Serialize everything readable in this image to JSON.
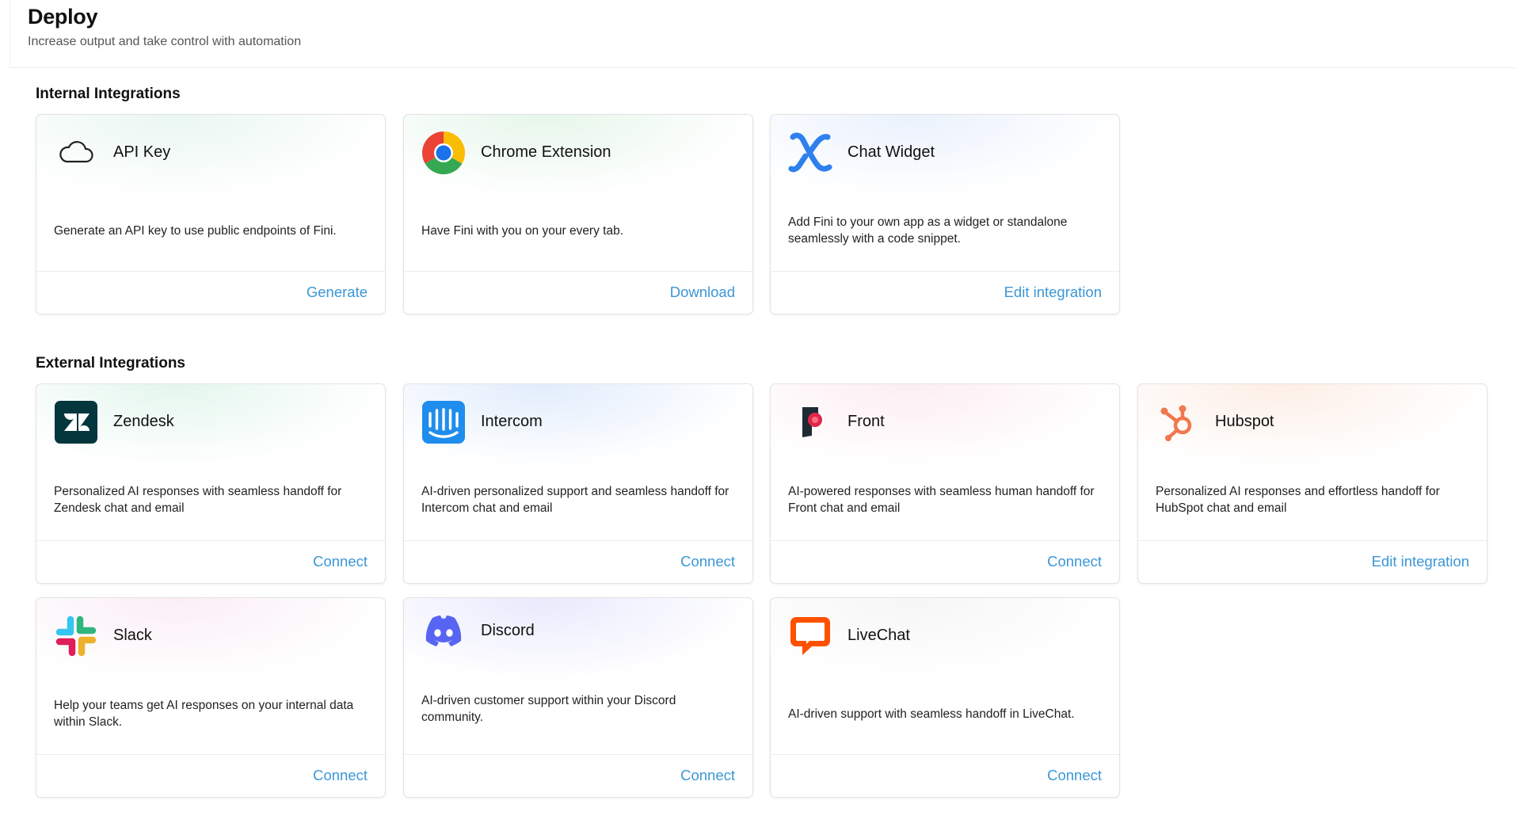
{
  "header": {
    "title": "Deploy",
    "subtitle": "Increase output and take control with automation"
  },
  "internal": {
    "title": "Internal Integrations",
    "cards": [
      {
        "name": "API Key",
        "description": "Generate an API key to use public endpoints of Fini.",
        "action": "Generate",
        "icon": "cloud-icon"
      },
      {
        "name": "Chrome Extension",
        "description": "Have Fini with you on your every tab.",
        "action": "Download",
        "icon": "chrome-icon"
      },
      {
        "name": "Chat Widget",
        "description": "Add Fini to your own app as a widget or standalone seamlessly with a code snippet.",
        "action": "Edit integration",
        "icon": "fini-logo-icon"
      }
    ]
  },
  "external": {
    "title": "External Integrations",
    "cards": [
      {
        "name": "Zendesk",
        "description": "Personalized AI responses with seamless handoff for Zendesk chat and email",
        "action": "Connect",
        "icon": "zendesk-icon"
      },
      {
        "name": "Intercom",
        "description": "AI-driven personalized support and seamless handoff for Intercom chat and email",
        "action": "Connect",
        "icon": "intercom-icon"
      },
      {
        "name": "Front",
        "description": "AI-powered responses with seamless human handoff for Front chat and email",
        "action": "Connect",
        "icon": "front-icon"
      },
      {
        "name": "Hubspot",
        "description": "Personalized AI responses and effortless handoff for HubSpot chat and email",
        "action": "Edit integration",
        "icon": "hubspot-icon"
      },
      {
        "name": "Slack",
        "description": "Help your teams get AI responses on your internal data within Slack.",
        "action": "Connect",
        "icon": "slack-icon"
      },
      {
        "name": "Discord",
        "description": "AI-driven customer support within your Discord community.",
        "action": "Connect",
        "icon": "discord-icon"
      },
      {
        "name": "LiveChat",
        "description": "AI-driven support with seamless handoff in LiveChat.",
        "action": "Connect",
        "icon": "livechat-icon"
      }
    ]
  },
  "colors": {
    "accent": "#3b97d6",
    "chat_widget_blue": "#2f80ed",
    "hubspot_orange": "#f0784d",
    "livechat_orange": "#ff5100",
    "discord_blurple": "#5865f2",
    "intercom_blue": "#1f8ded",
    "zendesk_dark": "#03363d"
  }
}
